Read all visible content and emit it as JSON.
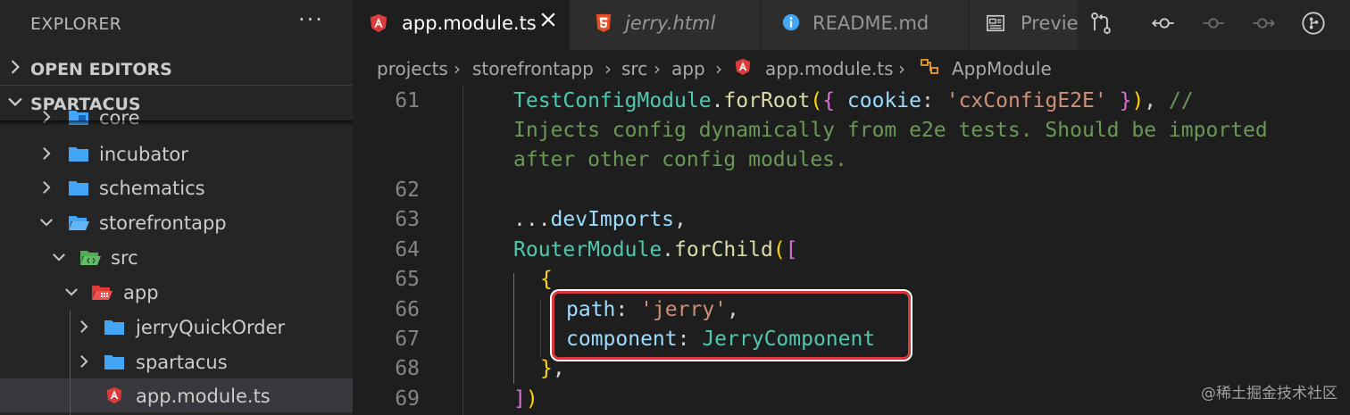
{
  "explorer": {
    "title": "EXPLORER",
    "more": "···",
    "sections": {
      "open_editors": "OPEN EDITORS",
      "project": "SPARTACUS"
    },
    "tree": [
      {
        "label": "core"
      },
      {
        "label": "incubator"
      },
      {
        "label": "schematics"
      },
      {
        "label": "storefrontapp"
      },
      {
        "label": "src"
      },
      {
        "label": "app"
      },
      {
        "label": "jerryQuickOrder"
      },
      {
        "label": "spartacus"
      },
      {
        "label": "app.module.ts"
      }
    ]
  },
  "tabs": [
    {
      "label": "app.module.ts",
      "icon": "angular-icon"
    },
    {
      "label": "jerry.html",
      "icon": "html5-icon"
    },
    {
      "label": "README.md",
      "icon": "info-icon"
    },
    {
      "label": "Previe",
      "icon": "preview-icon"
    }
  ],
  "breadcrumb": [
    "projects",
    "storefrontapp",
    "src",
    "app",
    "app.module.ts",
    "AppModule"
  ],
  "editor": {
    "lines": [
      {
        "n": "61"
      },
      {
        "n": "62"
      },
      {
        "n": "63"
      },
      {
        "n": "64"
      },
      {
        "n": "65"
      },
      {
        "n": "66"
      },
      {
        "n": "67"
      },
      {
        "n": "68"
      },
      {
        "n": "69"
      }
    ],
    "code": {
      "l61_a": "TestConfigModule",
      "l61_b": ".",
      "l61_c": "forRoot",
      "l61_d": "(",
      "l61_e": "{ ",
      "l61_f": "cookie",
      "l61_g": ": ",
      "l61_h": "'cxConfigE2E'",
      "l61_i": " }",
      "l61_j": ")",
      "l61_k": ", ",
      "l61_l": "//",
      "l61w1": "Injects config dynamically from e2e tests. Should be imported",
      "l61w2": "after other config modules.",
      "l63_a": "...",
      "l63_b": "devImports",
      "l63_c": ",",
      "l64_a": "RouterModule",
      "l64_b": ".",
      "l64_c": "forChild",
      "l64_d": "(",
      "l64_e": "[",
      "l65": "{",
      "l66_a": "path",
      "l66_b": ": ",
      "l66_c": "'jerry'",
      "l66_d": ",",
      "l67_a": "component",
      "l67_b": ": ",
      "l67_c": "JerryComponent",
      "l68_a": "}",
      "l68_b": ",",
      "l69_a": "]",
      "l69_b": ")"
    }
  },
  "watermark": "@稀土掘金技术社区",
  "colors": {
    "sidebar_bg": "#252526",
    "editor_bg": "#1e1e1e",
    "folder": "#42a5f5",
    "angular": "#dd3b3b",
    "highlight": "#d8383e"
  }
}
